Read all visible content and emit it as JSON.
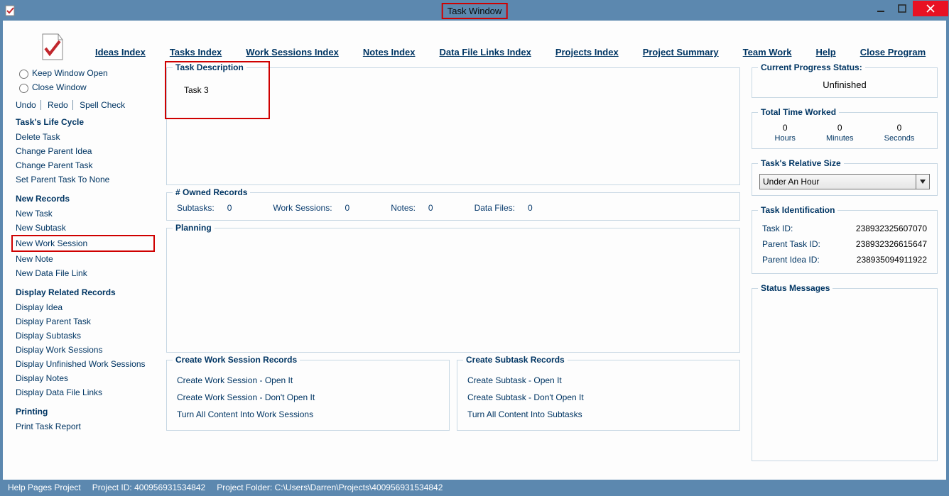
{
  "title": "Task Window",
  "menu": {
    "ideas": "Ideas Index",
    "tasks": "Tasks Index",
    "work_sessions": "Work Sessions Index",
    "notes": "Notes Index",
    "data_files": "Data File Links Index",
    "projects": "Projects Index",
    "summary": "Project Summary",
    "team": "Team Work",
    "help": "Help",
    "close": "Close Program"
  },
  "sidebar": {
    "keep_open": "Keep Window Open",
    "close_window": "Close Window",
    "undo": "Undo",
    "redo": "Redo",
    "spell": "Spell Check",
    "life_cycle": {
      "title": "Task's Life Cycle",
      "delete": "Delete Task",
      "change_parent_idea": "Change Parent Idea",
      "change_parent_task": "Change Parent Task",
      "set_parent_none": "Set Parent Task To None"
    },
    "new_records": {
      "title": "New Records",
      "task": "New Task",
      "subtask": "New Subtask",
      "work_session": "New Work Session",
      "note": "New Note",
      "data_file": "New Data File Link"
    },
    "display": {
      "title": "Display Related Records",
      "idea": "Display Idea",
      "parent_task": "Display Parent Task",
      "subtasks": "Display Subtasks",
      "work_sessions": "Display Work Sessions",
      "unfinished_ws": "Display Unfinished Work Sessions",
      "notes": "Display Notes",
      "links": "Display Data File Links"
    },
    "printing": {
      "title": "Printing",
      "report": "Print Task Report"
    }
  },
  "task_desc": {
    "legend": "Task Description",
    "text": "Task 3"
  },
  "owned": {
    "legend": "# Owned Records",
    "subtasks_lbl": "Subtasks:",
    "subtasks": "0",
    "work_lbl": "Work Sessions:",
    "work": "0",
    "notes_lbl": "Notes:",
    "notes": "0",
    "files_lbl": "Data Files:",
    "files": "0"
  },
  "planning": {
    "legend": "Planning"
  },
  "create_ws": {
    "legend": "Create Work Session Records",
    "open": "Create Work Session - Open It",
    "dont": "Create Work Session - Don't Open It",
    "turn": "Turn All Content Into Work Sessions"
  },
  "create_st": {
    "legend": "Create Subtask Records",
    "open": "Create Subtask - Open It",
    "dont": "Create Subtask - Don't Open It",
    "turn": "Turn All Content Into Subtasks"
  },
  "progress": {
    "legend": "Current Progress Status:",
    "value": "Unfinished"
  },
  "time": {
    "legend": "Total Time Worked",
    "hours": "0",
    "hours_lbl": "Hours",
    "mins": "0",
    "mins_lbl": "Minutes",
    "secs": "0",
    "secs_lbl": "Seconds"
  },
  "size": {
    "legend": "Task's Relative Size",
    "value": "Under An Hour"
  },
  "ident": {
    "legend": "Task Identification",
    "task_lbl": "Task ID:",
    "task_id": "238932325607070",
    "ptask_lbl": "Parent Task ID:",
    "ptask_id": "238932326615647",
    "pidea_lbl": "Parent Idea ID:",
    "pidea_id": "238935094911922"
  },
  "status_msg": {
    "legend": "Status Messages"
  },
  "footer": {
    "help": "Help Pages Project",
    "pid_lbl": "Project ID:",
    "pid": "400956931534842",
    "folder_lbl": "Project Folder:",
    "folder": "C:\\Users\\Darren\\Projects\\400956931534842"
  }
}
